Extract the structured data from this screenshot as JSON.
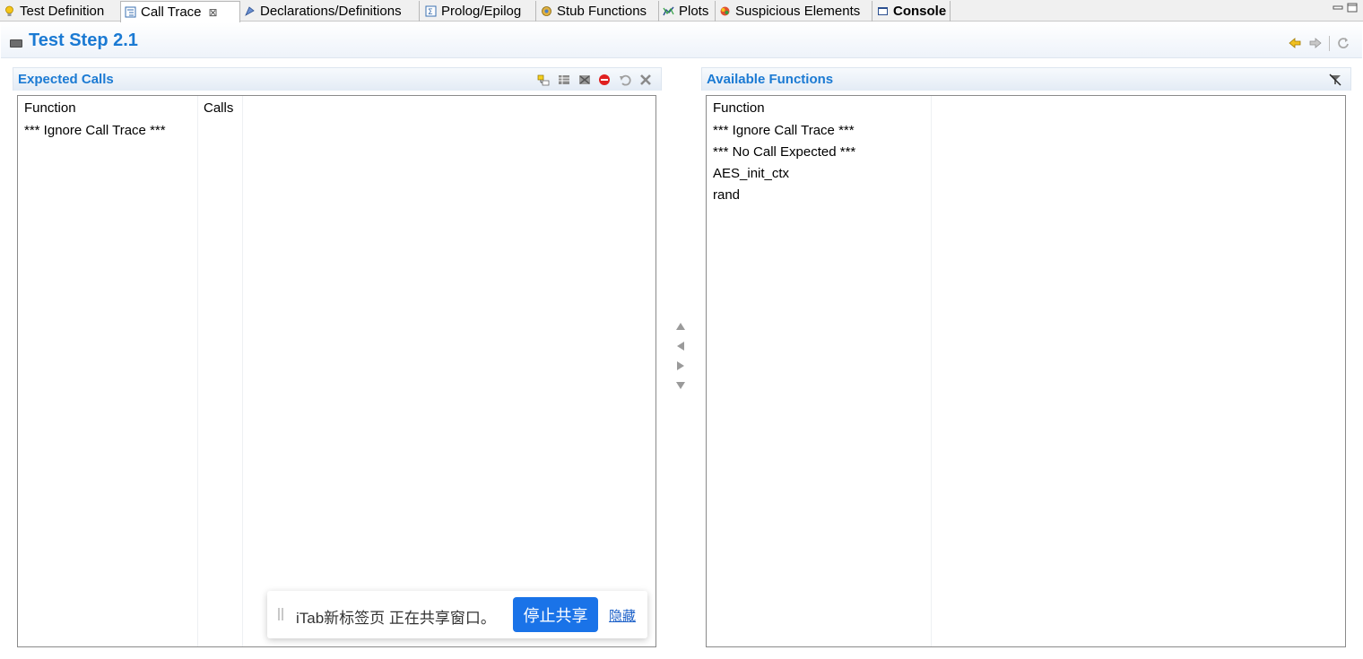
{
  "tabs": [
    {
      "label": "Test Definition",
      "icon": "lightbulb-icon"
    },
    {
      "label": "Call Trace",
      "icon": "call-trace-icon",
      "active": true,
      "close": "⊠"
    },
    {
      "label": "Declarations/Definitions",
      "icon": "declarations-icon"
    },
    {
      "label": "Prolog/Epilog",
      "icon": "prolog-epilog-icon"
    },
    {
      "label": "Stub Functions",
      "icon": "stub-functions-icon"
    },
    {
      "label": "Plots",
      "icon": "plots-icon"
    },
    {
      "label": "Suspicious Elements",
      "icon": "suspicious-elements-icon"
    },
    {
      "label": "Console",
      "icon": "console-icon"
    }
  ],
  "header": {
    "title": "Test Step 2.1"
  },
  "expected_calls": {
    "title": "Expected Calls",
    "columns": [
      "Function",
      "Calls"
    ],
    "rows": [
      {
        "function": "*** Ignore Call Trace ***",
        "calls": ""
      }
    ]
  },
  "available_functions": {
    "title": "Available Functions",
    "columns": [
      "Function"
    ],
    "rows": [
      "*** Ignore Call Trace ***",
      "*** No Call Expected ***",
      "AES_init_ctx",
      "rand"
    ]
  },
  "share_bar": {
    "message": "iTab新标签页 正在共享窗口。",
    "stop_label": "停止共享",
    "hide_label": "隐藏",
    "button_color": "#1a73e8"
  },
  "colors": {
    "accent": "#1b7ad3"
  }
}
